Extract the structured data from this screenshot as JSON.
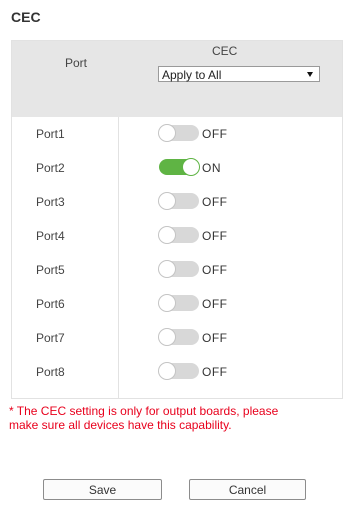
{
  "title": "CEC",
  "table": {
    "header_port": "Port",
    "header_cec": "CEC",
    "apply_select": {
      "value": "Apply to All",
      "icon": "chevron-down-icon"
    },
    "rows": [
      {
        "port": "Port1",
        "state": "OFF",
        "on": false
      },
      {
        "port": "Port2",
        "state": "ON",
        "on": true
      },
      {
        "port": "Port3",
        "state": "OFF",
        "on": false
      },
      {
        "port": "Port4",
        "state": "OFF",
        "on": false
      },
      {
        "port": "Port5",
        "state": "OFF",
        "on": false
      },
      {
        "port": "Port6",
        "state": "OFF",
        "on": false
      },
      {
        "port": "Port7",
        "state": "OFF",
        "on": false
      },
      {
        "port": "Port8",
        "state": "OFF",
        "on": false
      }
    ]
  },
  "note": {
    "line1": "* The CEC setting is only for output boards, please",
    "line2": "make sure all devices have this capability."
  },
  "buttons": {
    "save": "Save",
    "cancel": "Cancel"
  },
  "colors": {
    "toggle_on": "#5fb444",
    "toggle_off": "#d8d8d8",
    "note_red": "#e8001c",
    "header_bg": "#e6e6e6"
  }
}
